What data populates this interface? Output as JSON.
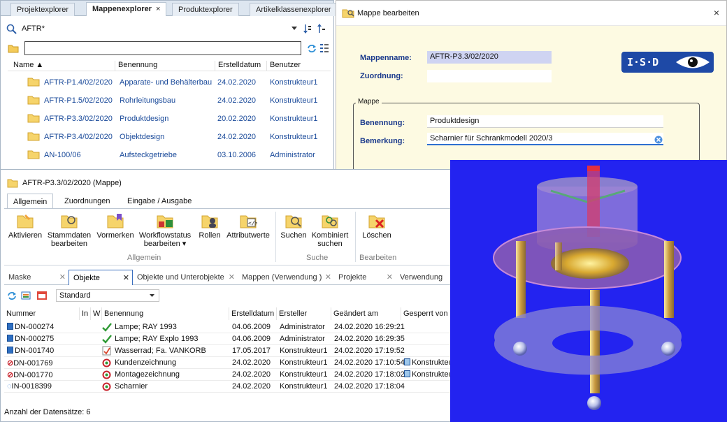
{
  "explorer": {
    "tabs": [
      {
        "label": "Projektexplorer"
      },
      {
        "label": "Mappenexplorer",
        "close": "×"
      },
      {
        "label": "Produktexplorer"
      },
      {
        "label": "Artikelklassenexplorer"
      }
    ],
    "search_text": "AFTR*",
    "filter_value": "",
    "columns": [
      "Name",
      "Benennung",
      "Erstelldatum",
      "Benutzer"
    ],
    "rows": [
      {
        "name": "AFTR-P1.4/02/2020",
        "benennung": "Apparate- und Behälterbau",
        "datum": "24.02.2020",
        "benutzer": "Konstrukteur1"
      },
      {
        "name": "AFTR-P1.5/02/2020",
        "benennung": "Rohrleitungsbau",
        "datum": "24.02.2020",
        "benutzer": "Konstrukteur1"
      },
      {
        "name": "AFTR-P3.3/02/2020",
        "benennung": "Produktdesign",
        "datum": "20.02.2020",
        "benutzer": "Konstrukteur1"
      },
      {
        "name": "AFTR-P3.4/02/2020",
        "benennung": "Objektdesign",
        "datum": "24.02.2020",
        "benutzer": "Konstrukteur1"
      },
      {
        "name": "AN-100/06",
        "benennung": "Aufsteckgetriebe",
        "datum": "03.10.2006",
        "benutzer": "Administrator"
      }
    ]
  },
  "dialog": {
    "title": "Mappe bearbeiten",
    "close": "×",
    "mappenname_label": "Mappenname:",
    "mappenname_value": "AFTR-P3.3/02/2020",
    "zuordnung_label": "Zuordnung:",
    "zuordnung_value": "",
    "group_label": "Mappe",
    "benennung_label": "Benennung:",
    "benennung_value": "Produktdesign",
    "bemerkung_label": "Bemerkung:",
    "bemerkung_value": "Scharnier für Schrankmodell 2020/3",
    "logo_text": "I·S·D"
  },
  "bottom": {
    "title": "AFTR-P3.3/02/2020 (Mappe)",
    "ribbon_tabs": [
      "Allgemein",
      "Zuordnungen",
      "Eingabe / Ausgabe"
    ],
    "ribbon_buttons": [
      {
        "line1": "Aktivieren",
        "line2": ""
      },
      {
        "line1": "Stammdaten",
        "line2": "bearbeiten"
      },
      {
        "line1": "Vormerken",
        "line2": ""
      },
      {
        "line1": "Workflowstatus",
        "line2": "bearbeiten ▾"
      },
      {
        "line1": "Rollen",
        "line2": ""
      },
      {
        "line1": "Attributwerte",
        "line2": ""
      },
      {
        "line1": "Suchen",
        "line2": ""
      },
      {
        "line1": "Kombiniert",
        "line2": "suchen"
      },
      {
        "line1": "Löschen",
        "line2": ""
      }
    ],
    "ribbon_groups": [
      "Allgemein",
      "Suche",
      "Bearbeiten"
    ],
    "module_tabs": [
      {
        "label": "Maske"
      },
      {
        "label": "Objekte"
      },
      {
        "label": "Objekte und Unterobjekte"
      },
      {
        "label": "Mappen (Verwendung )"
      },
      {
        "label": "Projekte"
      },
      {
        "label": "Verwendung"
      }
    ],
    "standard_select": "Standard",
    "grid_columns": [
      "Nummer",
      "In",
      "W",
      "Benennung",
      "Erstelldatum",
      "Ersteller",
      "Geändert am",
      "Gesperrt von"
    ],
    "grid_rows": [
      {
        "nummer": "DN-000274",
        "benennung": "Lampe; RAY 1993",
        "erstell": "04.06.2009",
        "ersteller": "Administrator",
        "geaendert": "24.02.2020 16:29:21",
        "gesperrt": ""
      },
      {
        "nummer": "DN-000275",
        "benennung": "Lampe; RAY Explo 1993",
        "erstell": "04.06.2009",
        "ersteller": "Administrator",
        "geaendert": "24.02.2020 16:29:35",
        "gesperrt": ""
      },
      {
        "nummer": "DN-001740",
        "benennung": "Wasserrad; Fa. VANKORB",
        "erstell": "17.05.2017",
        "ersteller": "Konstrukteur1",
        "geaendert": "24.02.2020 17:19:52",
        "gesperrt": ""
      },
      {
        "nummer": "DN-001769",
        "benennung": "Kundenzeichnung",
        "erstell": "24.02.2020",
        "ersteller": "Konstrukteur1",
        "geaendert": "24.02.2020 17:10:54",
        "gesperrt": "Konstrukteu"
      },
      {
        "nummer": "DN-001770",
        "benennung": "Montagezeichnung",
        "erstell": "24.02.2020",
        "ersteller": "Konstrukteur1",
        "geaendert": "24.02.2020 17:18:02",
        "gesperrt": "Konstrukteu"
      },
      {
        "nummer": "IN-0018399",
        "benennung": "Scharnier",
        "erstell": "24.02.2020",
        "ersteller": "Konstrukteur1",
        "geaendert": "24.02.2020 17:18:04",
        "gesperrt": ""
      }
    ],
    "status": "Anzahl der Datensätze: 6"
  },
  "colors": {
    "accent": "#1b3a8c",
    "render_bg": "#2323f0",
    "logo": "#1e49a6",
    "dialog_bg": "#fdfae2"
  }
}
